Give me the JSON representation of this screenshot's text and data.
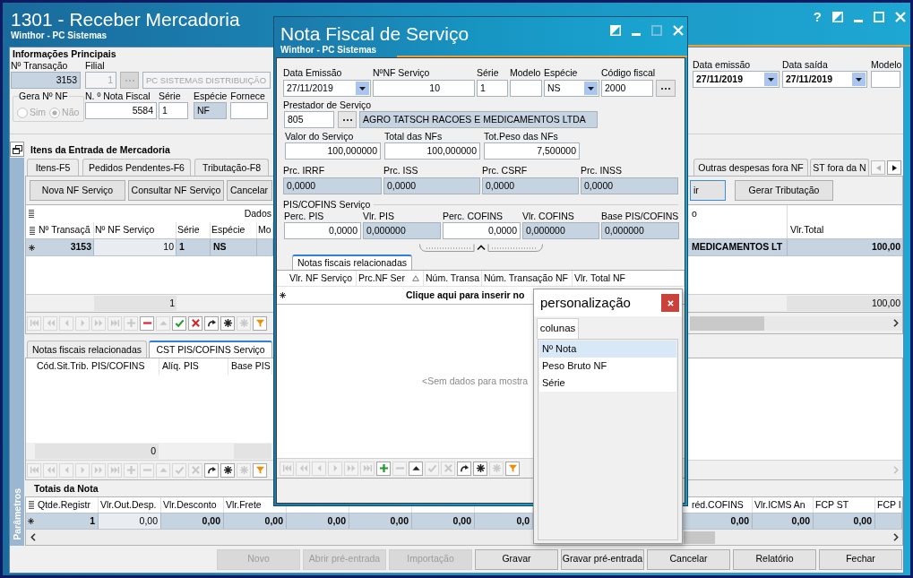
{
  "main_window": {
    "title": "1301 - Receber Mercadoria",
    "subtitle": "Winthor - PC Sistemas",
    "window_buttons": [
      {
        "kind": "help",
        "text": "?"
      },
      {
        "kind": "restore"
      },
      {
        "kind": "minimize"
      },
      {
        "kind": "maximize"
      },
      {
        "kind": "close"
      }
    ],
    "side_panel": {
      "label": "Parâmetros"
    },
    "main_info": {
      "title": "Informações Principais",
      "transaction": {
        "label": "Nº Transação",
        "value": "3153"
      },
      "branch": {
        "label": "Filial",
        "code": "1",
        "name": "PC SISTEMAS DISTRIBUIÇÃO",
        "disabled": true
      },
      "generate_number": {
        "label": "Gera Nº NF",
        "disabled": true,
        "options": [
          {
            "label": "Sim",
            "selected": false
          },
          {
            "label": "Não",
            "selected": true
          }
        ]
      },
      "invoice_number": {
        "label": "N. º Nota Fiscal",
        "value": "5584"
      },
      "series": {
        "label": "Série",
        "value": "1"
      },
      "species": {
        "label": "Espécie",
        "value": "NF"
      },
      "supplier": {
        "label": "Fornece"
      },
      "issue_date": {
        "label": "Data emissão",
        "value": "27/11/2019"
      },
      "exit_date": {
        "label": "Data saída",
        "value": "27/11/2019"
      },
      "model": {
        "label": "Modelo"
      }
    },
    "items_section": {
      "title": "Itens da Entrada de Mercadoria",
      "tabs": [
        {
          "label": "Itens-F5",
          "selected": false
        },
        {
          "label": "Pedidos Pendentes-F6",
          "selected": false
        },
        {
          "label": "Tributação-F8",
          "selected": false
        },
        {
          "label": "Outras despesas fora NF",
          "selected": false
        },
        {
          "label": "ST fora da N",
          "selected": false
        }
      ],
      "buttons": [
        {
          "label": "Nova NF Serviço",
          "focused": false
        },
        {
          "label": "Consultar NF Serviço",
          "focused": false
        },
        {
          "label": "Cancelar",
          "focused": false
        },
        {
          "label": "ir",
          "focused": true
        },
        {
          "label": "Gerar Tributação",
          "focused": false
        }
      ],
      "grid": {
        "band_labels": [
          "Dados",
          "o"
        ],
        "left_columns": [
          {
            "header": "Nº Transaçã",
            "value": "3153",
            "focused": false
          },
          {
            "header": "Nº NF Serviço",
            "value": "10",
            "focused": true
          },
          {
            "header": "Série",
            "value": "1",
            "focused": false
          },
          {
            "header": "Espécie",
            "value": "NS",
            "focused": false
          },
          {
            "header": "Mo",
            "focused": false
          }
        ],
        "right_columns": [
          {
            "value": "MEDICAMENTOS LT",
            "focused": false
          },
          {
            "header": "Vlr.Total",
            "value": "100,00",
            "focused": false
          }
        ],
        "footer": [
          "1",
          "100,00"
        ]
      },
      "navigator": [
        {
          "kind": "first",
          "disabled": true
        },
        {
          "kind": "prev_page",
          "disabled": true
        },
        {
          "kind": "prev",
          "disabled": true
        },
        {
          "kind": "next",
          "disabled": true
        },
        {
          "kind": "next_page",
          "disabled": true
        },
        {
          "kind": "last",
          "disabled": true
        },
        {
          "kind": "insert",
          "disabled": true
        },
        {
          "kind": "delete",
          "disabled": false
        },
        {
          "kind": "edit",
          "disabled": true
        },
        {
          "kind": "post",
          "disabled": false
        },
        {
          "kind": "cancel",
          "disabled": false
        },
        {
          "kind": "refresh",
          "disabled": false
        },
        {
          "kind": "asterisk",
          "disabled": false
        },
        {
          "kind": "asterisk_light",
          "disabled": true
        },
        {
          "kind": "filter",
          "disabled": false
        }
      ]
    },
    "cst_section": {
      "tabs": [
        {
          "label": "Notas fiscais relacionadas",
          "selected": false
        },
        {
          "label": "CST PIS/COFINS Serviço",
          "selected": true
        }
      ],
      "grid": {
        "columns": [
          "Cód.Sit.Trib. PIS/COFINS",
          "Alíq. PIS",
          "Base PIS"
        ],
        "footer": "0"
      },
      "navigator": [
        {
          "kind": "first",
          "disabled": true
        },
        {
          "kind": "prev_page",
          "disabled": true
        },
        {
          "kind": "prev",
          "disabled": true
        },
        {
          "kind": "next",
          "disabled": true
        },
        {
          "kind": "next_page",
          "disabled": true
        },
        {
          "kind": "last",
          "disabled": true
        },
        {
          "kind": "insert",
          "disabled": true
        },
        {
          "kind": "delete",
          "disabled": true
        },
        {
          "kind": "edit",
          "disabled": true
        },
        {
          "kind": "post",
          "disabled": true
        },
        {
          "kind": "cancel",
          "disabled": true
        },
        {
          "kind": "refresh",
          "disabled": false
        },
        {
          "kind": "asterisk",
          "disabled": false
        },
        {
          "kind": "asterisk_light",
          "disabled": true
        },
        {
          "kind": "filter",
          "disabled": false
        }
      ]
    },
    "totals_section": {
      "title": "Totais da Nota",
      "left_columns": [
        {
          "header": "Qtde.Registr",
          "value": "1",
          "focused": false
        },
        {
          "header": "Vlr.Out.Desp.",
          "value": "0,00",
          "focused": true
        },
        {
          "header": "Vlr.Desconto",
          "value": "0,00",
          "focused": false
        },
        {
          "header": "Vlr.Frete",
          "value": "0,00",
          "focused": false
        },
        {
          "value": "0,00",
          "focused": false
        },
        {
          "value": "0,00",
          "focused": false
        },
        {
          "value": "0,00",
          "focused": false
        },
        {
          "value": "0,0",
          "focused": false
        }
      ],
      "right_columns": [
        {
          "header": "réd.COFINS",
          "value": "0,00",
          "focused": false
        },
        {
          "header": "Vlr.ICMS An",
          "value": "0,00",
          "focused": false
        },
        {
          "header": "FCP ST",
          "value": "0,00",
          "focused": false
        },
        {
          "header": "FCP I",
          "focused": false
        }
      ]
    },
    "bottom_buttons": [
      {
        "label": "Novo",
        "disabled": true
      },
      {
        "label": "Abrir pré-entrada",
        "disabled": true
      },
      {
        "label": "Importação",
        "disabled": true
      },
      {
        "label": "Gravar",
        "disabled": false
      },
      {
        "label": "Gravar pré-entrada",
        "disabled": false
      },
      {
        "label": "Cancelar",
        "disabled": false
      },
      {
        "label": "Relatório",
        "disabled": false
      },
      {
        "label": "Fechar",
        "disabled": false
      }
    ]
  },
  "service_dialog": {
    "title": "Nota Fiscal de Serviço",
    "subtitle": "Winthor - PC Sistemas",
    "window_buttons": [
      {
        "kind": "restore",
        "disabled": false
      },
      {
        "kind": "minimize",
        "disabled": false
      },
      {
        "kind": "maximize",
        "disabled": true
      },
      {
        "kind": "close",
        "disabled": false
      }
    ],
    "header_fields": [
      {
        "kind": "date",
        "label": "Data Emissão",
        "value": "27/11/2019"
      },
      {
        "kind": "number",
        "label": "NºNF Serviço",
        "value": "10"
      },
      {
        "kind": "text",
        "label": "Série",
        "value": "1"
      },
      {
        "kind": "text",
        "label": "Modelo"
      },
      {
        "kind": "select",
        "label": "Espécie",
        "value": "NS"
      },
      {
        "kind": "lookup",
        "label": "Código fiscal",
        "value": "2000"
      }
    ],
    "provider": {
      "label": "Prestador de Serviço",
      "code": "805",
      "name": "AGRO TATSCH RACOES E MEDICAMENTOS LTDA"
    },
    "amounts": [
      {
        "label": "Valor do Serviço",
        "value": "100,000000"
      },
      {
        "label": "Total das NFs",
        "value": "100,000000"
      },
      {
        "label": "Tot.Peso das NFs",
        "value": "7,500000"
      }
    ],
    "rates": [
      {
        "label": "Prc. IRRF",
        "value": "0,0000"
      },
      {
        "label": "Prc. ISS",
        "value": "0,0000"
      },
      {
        "label": "Prc. CSRF",
        "value": "0,0000"
      },
      {
        "label": "Prc. INSS",
        "value": "0,0000"
      }
    ],
    "pis_cofins": {
      "title": "PIS/COFINS Serviço",
      "fields": [
        {
          "label": "Perc. PIS",
          "value": "0,0000",
          "readonly": false
        },
        {
          "label": "Vlr. PIS",
          "value": "0,000000",
          "readonly": true
        },
        {
          "label": "Perc. COFINS",
          "value": "0,0000",
          "readonly": false
        },
        {
          "label": "Vlr. COFINS",
          "value": "0,000000",
          "readonly": true
        },
        {
          "label": "Base PIS/COFINS",
          "value": "0,000000",
          "readonly": true
        }
      ]
    },
    "tabs": [
      {
        "label": "Notas fiscais relacionadas",
        "selected": true
      }
    ],
    "grid": {
      "columns": [
        {
          "header": "Vlr. NF Serviço",
          "sorted": false
        },
        {
          "header": "Prc.NF Ser",
          "sorted": true
        },
        {
          "header": "Núm. Transa",
          "sorted": false
        },
        {
          "header": "Núm. Transação NF",
          "sorted": false
        },
        {
          "header": "Vlr. Total NF",
          "sorted": false
        }
      ],
      "new_row_prompt": "Clique aqui para inserir no",
      "empty_text": "<Sem dados para mostra"
    },
    "navigator": [
      {
        "kind": "first",
        "disabled": true
      },
      {
        "kind": "prev_page",
        "disabled": true
      },
      {
        "kind": "prev",
        "disabled": true
      },
      {
        "kind": "next",
        "disabled": true
      },
      {
        "kind": "next_page",
        "disabled": true
      },
      {
        "kind": "last",
        "disabled": true
      },
      {
        "kind": "insert",
        "disabled": false
      },
      {
        "kind": "delete",
        "disabled": true
      },
      {
        "kind": "edit",
        "disabled": false
      },
      {
        "kind": "post",
        "disabled": true
      },
      {
        "kind": "cancel",
        "disabled": true
      },
      {
        "kind": "refresh",
        "disabled": false
      },
      {
        "kind": "asterisk",
        "disabled": false
      },
      {
        "kind": "asterisk_light",
        "disabled": true
      },
      {
        "kind": "filter",
        "disabled": false
      }
    ]
  },
  "customize_popup": {
    "title": "personalização",
    "tabs": [
      {
        "label": "colunas",
        "selected": true
      }
    ],
    "items": [
      {
        "label": "Nº Nota",
        "selected": true
      },
      {
        "label": "Peso Bruto NF",
        "selected": false
      },
      {
        "label": "Série",
        "selected": false
      }
    ]
  }
}
